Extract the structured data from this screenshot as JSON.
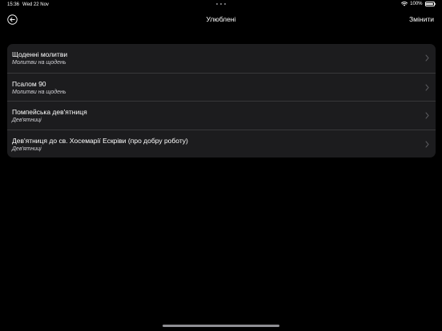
{
  "status_bar": {
    "time": "15:36",
    "date": "Wed 22 Nov",
    "battery": "100%",
    "wifi_icon": "wifi-icon",
    "battery_icon": "battery-icon"
  },
  "nav": {
    "back_icon": "circle-arrow-left-icon",
    "title": "Улюблені",
    "edit_label": "Змінити"
  },
  "favorites": [
    {
      "title": "Щоденні молитви",
      "subtitle": "Молитви на щодень"
    },
    {
      "title": "Псалом 90",
      "subtitle": "Молитви на щодень"
    },
    {
      "title": "Помпейська дев'ятниця",
      "subtitle": "Дев'ятниці"
    },
    {
      "title": "Дев'ятниця до св. Хосемарії Ескріви (про добру роботу)",
      "subtitle": "Дев'ятниці"
    }
  ],
  "colors": {
    "background": "#000000",
    "card": "#1c1c1e",
    "separator": "#38383a",
    "text": "#ffffff",
    "chevron": "#5a5a5e"
  }
}
